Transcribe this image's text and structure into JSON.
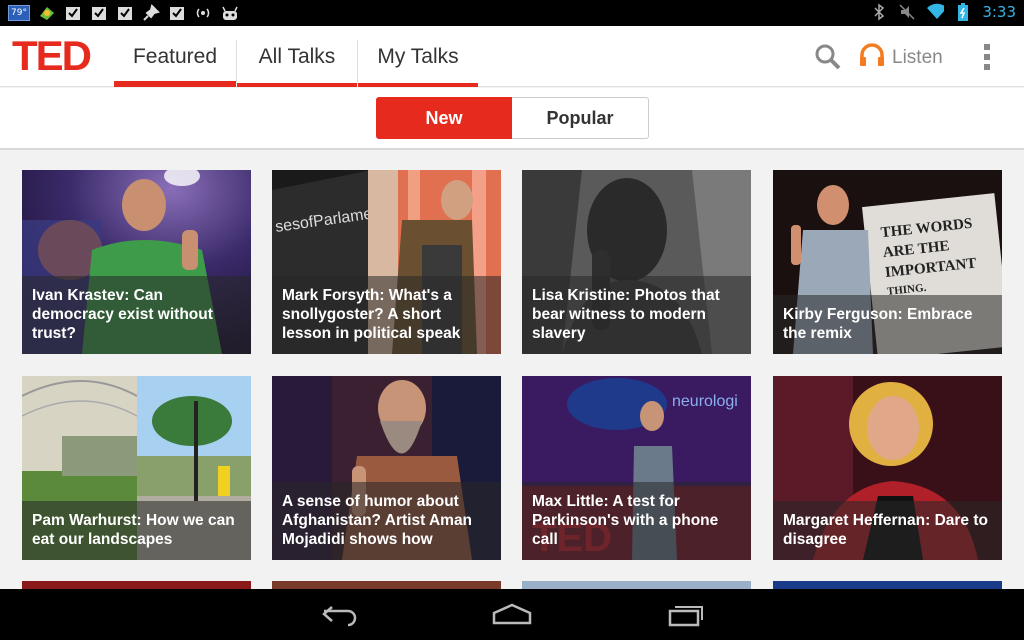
{
  "status_bar": {
    "temperature": "79°",
    "time": "3:33",
    "left_icons": [
      "weather-icon",
      "app-icon",
      "checklist-icon",
      "checklist-icon",
      "checklist-icon",
      "pin-icon",
      "checklist-icon",
      "wireless-icon",
      "android-icon"
    ],
    "right_icons": [
      "bluetooth-icon",
      "mute-icon",
      "wifi-icon",
      "battery-icon"
    ]
  },
  "app": {
    "logo": "TED",
    "tabs": [
      {
        "label": "Featured",
        "selected": true
      },
      {
        "label": "All Talks",
        "selected": false
      },
      {
        "label": "My Talks",
        "selected": false
      }
    ],
    "listen_label": "Listen",
    "accent": "#e62b1e",
    "listen_color": "#f47c20"
  },
  "segments": {
    "new_label": "New",
    "popular_label": "Popular",
    "selected": "New"
  },
  "talks": [
    {
      "title": "Ivan Krastev: Can democracy exist without trust?"
    },
    {
      "title": "Mark Forsyth: What's a snollygoster? A short lesson in political speak"
    },
    {
      "title": "Lisa Kristine: Photos that bear witness to modern slavery"
    },
    {
      "title": "Kirby Ferguson: Embrace the remix"
    },
    {
      "title": "Pam Warhurst: How we can eat our landscapes"
    },
    {
      "title": "A sense of humor about Afghanistan? Artist Aman Mojadidi shows how"
    },
    {
      "title": "Max Little: A test for Parkinson's with a phone call"
    },
    {
      "title": "Margaret Heffernan: Dare to disagree"
    }
  ],
  "navbar": {
    "icons": [
      "back-icon",
      "home-icon",
      "recents-icon"
    ]
  }
}
